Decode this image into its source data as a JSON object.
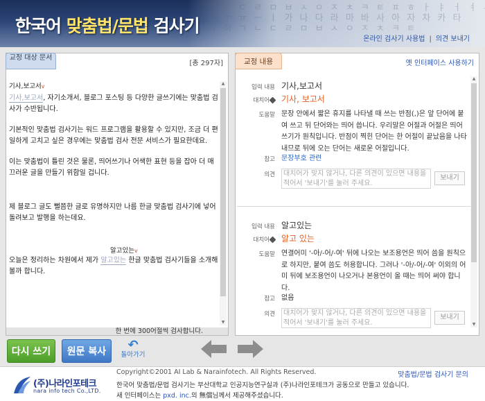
{
  "header": {
    "title_prefix": "한국어 ",
    "title_highlight": "맞춤법/문법",
    "title_suffix": " 검사기",
    "link_usage": "온라인 검사기 사용법",
    "link_feedback": "의견 보내기",
    "separator": "|"
  },
  "left": {
    "tab_label": "교정 대상 문서",
    "char_count": "[총 297자]",
    "footer_text": "한 번에 300어절씩 검사합니다.",
    "sug1": "기사,보고서",
    "err1": "기사,보고서",
    "p1_rest": ", 자기소개서, 블로그 포스팅 등 다양한 글쓰기에는 맞춤법 검사가 수반됩니다.",
    "p2": "기본적인 맞춤법 검사기는 워드 프로그램을 활용할 수 있지만, 조금 더 편일하게 고치고 싶은 경우에는 맞춤법 검사 전문 서비스가 필요한데요.",
    "p3": "이는 맞춤법이 틀린 것은 물론, 띄어쓰기나 어색한 표현 등을 잡아 더 매끄러운 글을 만들기 위함일 겁니다.",
    "p4": "제 블로그 글도 뻘쯤한 글로 유명하지만 나름 한글 맞춤법 검사기에 넣어 돌려보고 발행을 하는데요.",
    "sug2": "알고있는",
    "p5_pre": "오늘은 정리하는 차원에서 제가 ",
    "err2": "알고있는",
    "p5_post": " 한글 맞춤법 검사기들을 소개해 볼까 합니다."
  },
  "right": {
    "tab_label": "교정 내용",
    "old_ui_link": "옛 인터페이스 사용하기",
    "labels": {
      "input": "입력 내용",
      "replace": "대치어",
      "help": "도움말",
      "ref": "참고",
      "opinion": "의견"
    },
    "entries": [
      {
        "input": "기사,보고서",
        "replacement": "기사, 보고서",
        "help": "문장 안에서 짧은 휴지를 나타낼 때 쓰는 반점(,)은 앞 단어에 붙여 쓰고 뒤 단어와는 띄어 씁니다. 우리말은 어절과 어절은 띄어쓰기가 원칙입니다. 반점이 찍힌 단어는 한 어절이 끝났음을 나타내므로 뒤에 오는 단어는 새로운 어절입니다.",
        "reference": "문장부호 관련",
        "opinion_placeholder": "대치어가 맞지 않거나, 다른 의견이 있으면 내용을 적어서 '보내기'를 눌러 주세요.",
        "send_label": "보내기"
      },
      {
        "input": "알고있는",
        "replacement": "알고 있는",
        "help": "연결어미 '-아/-어/-여' 뒤에 나오는 보조용언은 띄어 씀을 원칙으로 하지만, 붙여 씀도 허용합니다. 그러나 '-아/-어/-여' 이외의 어미 뒤에 보조용언이 나오거나 본용언이 올 때는 띄어 써야 합니다.",
        "reference": "없음",
        "opinion_placeholder": "대치어가 맞지 않거나, 다른 의견이 있으면 내용을 적어서 '보내기'를 눌러 주세요.",
        "send_label": "보내기"
      }
    ]
  },
  "buttons": {
    "rewrite": "다시 쓰기",
    "copy": "원문 복사",
    "back": "돌아가기"
  },
  "footer": {
    "copyright": "Copyright©2001 AI Lab & Narainfotech. All Rights Reserved.",
    "inquiry": "맞춤법/문법 검사기 문의",
    "credit1": "한국어 맞춤법/문법 검사기는 부산대학교 인공지능연구실과 (주)나라인포테크가 공동으로 만들고 있습니다.",
    "credit2_pre": "새 인터페이스는 ",
    "credit2_link": "pxd. inc.",
    "credit2_post": "의 無償님께서 제공해주셨습니다.",
    "logo_ko": "(주)나라인포테크",
    "logo_en": "nara info tech Co.,LTD."
  },
  "colors": {
    "header_bg": "#2b4577",
    "title_highlight": "#ffe36b",
    "suggestion": "#e85b1a",
    "link": "#2a56b8",
    "green_button": "#5aa836",
    "blue_button": "#4a82cc"
  }
}
